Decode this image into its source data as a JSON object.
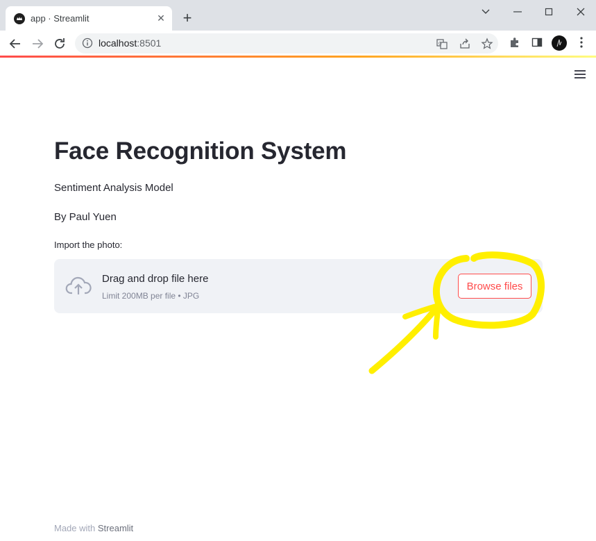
{
  "browser": {
    "tab_title": "app · Streamlit",
    "url_host": "localhost",
    "url_port": ":8501"
  },
  "app": {
    "title": "Face Recognition System",
    "subtitle": "Sentiment Analysis Model",
    "byline": "By Paul Yuen",
    "uploader": {
      "label": "Import the photo:",
      "drop_text": "Drag and drop file here",
      "limit_text": "Limit 200MB per file • JPG",
      "button_label": "Browse files"
    },
    "footer": {
      "prefix": "Made with ",
      "brand": "Streamlit"
    }
  },
  "colors": {
    "accent": "#ff4b4b",
    "annotation": "#ffef00",
    "text": "#262730",
    "dropzone_bg": "#f0f2f6"
  }
}
